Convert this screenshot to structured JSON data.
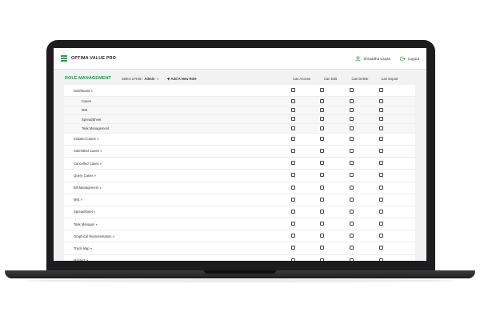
{
  "app": {
    "title": "OPTIMA VALUE PRO"
  },
  "user": {
    "name": "Shraddha Gupta",
    "logout_label": "Logout"
  },
  "page": {
    "title": "ROLE MANAGEMENT",
    "select_role_label": "Select a Role :",
    "selected_role": "Admin",
    "add_role_label": "Add A New Role"
  },
  "columns": [
    "Can Access",
    "Can Edit",
    "Can Delete",
    "Can Export"
  ],
  "rows": [
    {
      "label": "Dashboard",
      "sub": false,
      "expanded": true
    },
    {
      "label": "Cases",
      "sub": true
    },
    {
      "label": "MIS",
      "sub": true
    },
    {
      "label": "SpreadSheet",
      "sub": true
    },
    {
      "label": "Task Management",
      "sub": true
    },
    {
      "label": "Initiated Cases",
      "sub": false
    },
    {
      "label": "Submitted Cases",
      "sub": false
    },
    {
      "label": "Cancelled Cases",
      "sub": false
    },
    {
      "label": "Query Cases",
      "sub": false
    },
    {
      "label": "Bill Management",
      "sub": false
    },
    {
      "label": "MIS",
      "sub": false
    },
    {
      "label": "Spreadsheet",
      "sub": false
    },
    {
      "label": "Task Manager",
      "sub": false
    },
    {
      "label": "Graphical Representation",
      "sub": false
    },
    {
      "label": "Track Map",
      "sub": false
    },
    {
      "label": "Masters",
      "sub": false
    }
  ],
  "colors": {
    "accent": "#2e9a4a",
    "frame": "#1d1d1f",
    "content_bg": "#f2f2f2"
  },
  "icons": {
    "menu": "hamburger-icon",
    "user": "user-icon",
    "logout": "logout-icon",
    "expand": "chevron-down-icon"
  }
}
